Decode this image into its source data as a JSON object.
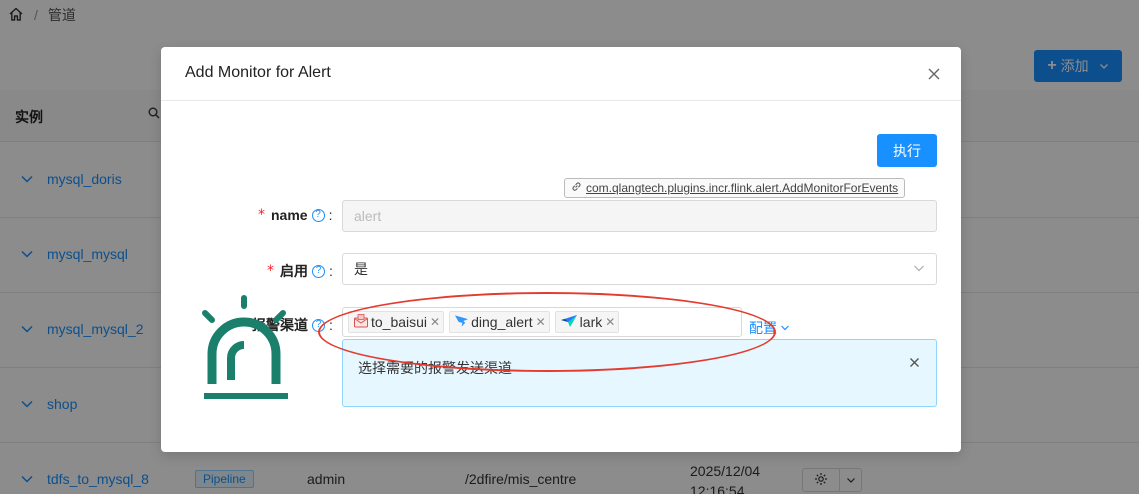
{
  "breadcrumb": {
    "home_icon": "home-icon",
    "separator": "/",
    "current": "管道"
  },
  "toolbar": {
    "add_label": "添加",
    "add_prefix": "+",
    "add_dropdown_icon": "chevron-down-icon"
  },
  "table": {
    "column_instance": "实例",
    "rows": [
      {
        "name": "mysql_doris"
      },
      {
        "name": "mysql_mysql"
      },
      {
        "name": "mysql_mysql_2"
      },
      {
        "name": "shop"
      },
      {
        "name": "tdfs_to_mysql_8",
        "tag": "Pipeline",
        "owner": "admin",
        "path": "/2dfire/mis_centre",
        "time_line1": "2025/12/04",
        "time_line2": "12:16:54"
      }
    ]
  },
  "modal": {
    "title": "Add Monitor for Alert",
    "execute_label": "执行",
    "plugin_class": "com.qlangtech.plugins.incr.flink.alert.AddMonitorForEvents",
    "fields": {
      "name": {
        "label": "name",
        "placeholder": "alert"
      },
      "enable": {
        "label": "启用",
        "value": "是"
      },
      "channels": {
        "label": "报警渠道",
        "tags": [
          {
            "label": "to_baisui",
            "icon": "mail-alert-icon"
          },
          {
            "label": "ding_alert",
            "icon": "dingtalk-icon"
          },
          {
            "label": "lark",
            "icon": "lark-icon"
          }
        ],
        "config_label": "配置",
        "info_message": "选择需要的报警发送渠道"
      }
    }
  },
  "colors": {
    "primary": "#1890ff",
    "required": "#f5222d",
    "annotation": "#e33b2e",
    "siren": "#1a7f6b"
  }
}
